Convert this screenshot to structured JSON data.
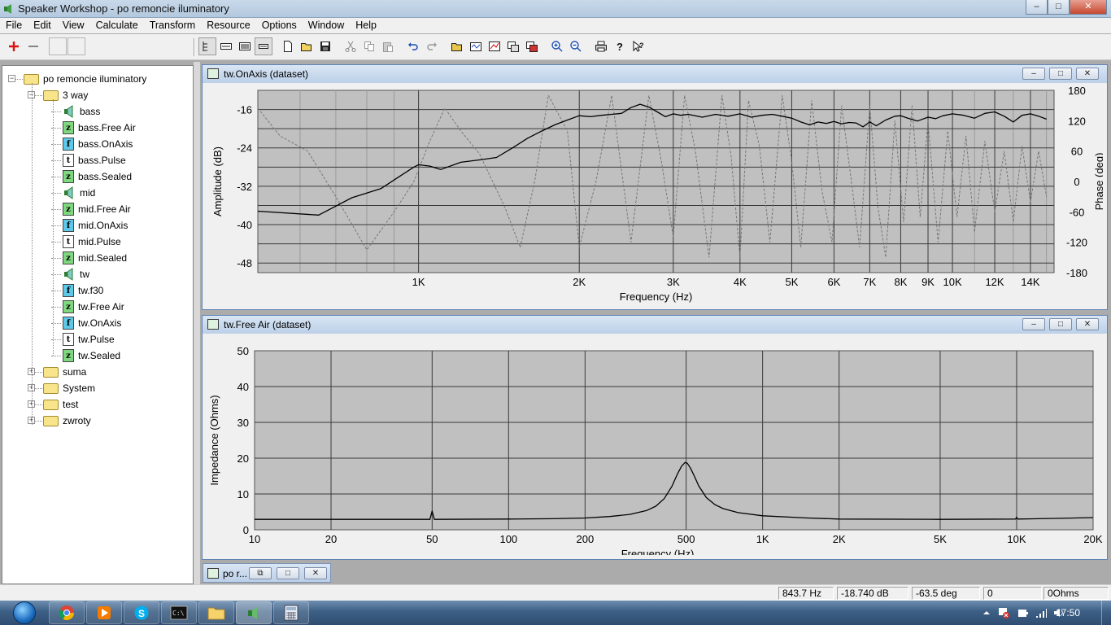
{
  "window": {
    "title": "Speaker Workshop - po remoncie iluminatory",
    "minimize": "–",
    "maximize": "□",
    "close": "✕"
  },
  "menu": [
    "File",
    "Edit",
    "View",
    "Calculate",
    "Transform",
    "Resource",
    "Options",
    "Window",
    "Help"
  ],
  "toolbar": {
    "icons": [
      "add-icon",
      "remove-icon",
      "blank-icon",
      "blank-icon",
      "tree-view-icon",
      "list-icon",
      "details-icon",
      "grid-icon",
      "new-document-icon",
      "open-folder-icon",
      "save-icon",
      "cut-icon",
      "copy-icon",
      "paste-icon",
      "undo-icon",
      "redo-icon",
      "open-icon",
      "chart-icon",
      "graph-icon",
      "window-icon",
      "window-close-icon",
      "zoom-in-icon",
      "zoom-out-icon",
      "print-icon",
      "help-icon",
      "context-help-icon"
    ]
  },
  "tree": {
    "root": "po remoncie iluminatory",
    "group": "3 way",
    "items": [
      {
        "label": "bass",
        "icon": "speaker"
      },
      {
        "label": "bass.Free Air",
        "icon": "z"
      },
      {
        "label": "bass.OnAxis",
        "icon": "f"
      },
      {
        "label": "bass.Pulse",
        "icon": "t"
      },
      {
        "label": "bass.Sealed",
        "icon": "z"
      },
      {
        "label": "mid",
        "icon": "speaker"
      },
      {
        "label": "mid.Free Air",
        "icon": "z"
      },
      {
        "label": "mid.OnAxis",
        "icon": "f"
      },
      {
        "label": "mid.Pulse",
        "icon": "t"
      },
      {
        "label": "mid.Sealed",
        "icon": "z"
      },
      {
        "label": "tw",
        "icon": "speaker"
      },
      {
        "label": "tw.f30",
        "icon": "f"
      },
      {
        "label": "tw.Free Air",
        "icon": "z"
      },
      {
        "label": "tw.OnAxis",
        "icon": "f"
      },
      {
        "label": "tw.Pulse",
        "icon": "t"
      },
      {
        "label": "tw.Sealed",
        "icon": "z"
      }
    ],
    "folders": [
      "suma",
      "System",
      "test",
      "zwroty"
    ]
  },
  "windows": {
    "onaxis_title": "tw.OnAxis (dataset)",
    "freeair_title": "tw.Free Air (dataset)",
    "minimized_title": "po r...",
    "btn_min": "–",
    "btn_max": "□",
    "btn_restore": "⧉",
    "btn_close": "✕"
  },
  "chart_data": [
    {
      "type": "line",
      "xlabel": "Frequency (Hz)",
      "ylabel": "Amplitude (dB)",
      "y2label": "Phase (deg)",
      "x_scale": "log",
      "xlim": [
        500,
        15500
      ],
      "ylim": [
        -50,
        -12
      ],
      "y2lim": [
        -180,
        180
      ],
      "x_ticks": [
        {
          "value": 1000,
          "label": "1K"
        },
        {
          "value": 2000,
          "label": "2K"
        },
        {
          "value": 3000,
          "label": "3K"
        },
        {
          "value": 4000,
          "label": "4K"
        },
        {
          "value": 5000,
          "label": "5K"
        },
        {
          "value": 6000,
          "label": "6K"
        },
        {
          "value": 7000,
          "label": "7K"
        },
        {
          "value": 8000,
          "label": "8K"
        },
        {
          "value": 9000,
          "label": "9K"
        },
        {
          "value": 10000,
          "label": "10K"
        },
        {
          "value": 12000,
          "label": "12K"
        },
        {
          "value": 14000,
          "label": "14K"
        }
      ],
      "y_ticks": [
        -16,
        -24,
        -32,
        -40,
        -48
      ],
      "y2_ticks": [
        180,
        120,
        60,
        0,
        -60,
        -120,
        -180
      ],
      "grid": true,
      "series": [
        {
          "role": "amplitude",
          "style": "solid",
          "color": "#000000",
          "x": [
            500,
            650,
            750,
            850,
            920,
            980,
            1000,
            1050,
            1100,
            1200,
            1300,
            1400,
            1500,
            1600,
            1700,
            1800,
            1900,
            2000,
            2100,
            2200,
            2300,
            2400,
            2500,
            2600,
            2700,
            2800,
            2900,
            3000,
            3100,
            3200,
            3400,
            3600,
            3800,
            4000,
            4200,
            4400,
            4600,
            4800,
            5000,
            5200,
            5400,
            5600,
            5800,
            6000,
            6200,
            6400,
            6600,
            6800,
            7000,
            7200,
            7500,
            7800,
            8000,
            8300,
            8600,
            9000,
            9300,
            9600,
            10000,
            10500,
            11000,
            11500,
            12000,
            12500,
            13000,
            13500,
            14000,
            14500,
            15000
          ],
          "y": [
            -37.2,
            -38.0,
            -34.4,
            -32.5,
            -30.0,
            -28.0,
            -27.5,
            -27.8,
            -28.5,
            -27.0,
            -26.5,
            -26.0,
            -24.0,
            -22.0,
            -20.5,
            -19.2,
            -18.2,
            -17.3,
            -17.5,
            -17.2,
            -17.0,
            -16.8,
            -15.6,
            -14.9,
            -15.5,
            -16.5,
            -17.5,
            -16.9,
            -17.2,
            -17.0,
            -17.6,
            -17.0,
            -17.4,
            -16.9,
            -17.6,
            -17.2,
            -17.0,
            -17.4,
            -17.8,
            -18.6,
            -19.2,
            -18.6,
            -18.9,
            -18.5,
            -19.0,
            -18.7,
            -18.8,
            -19.6,
            -18.6,
            -19.4,
            -18.2,
            -17.4,
            -17.3,
            -17.9,
            -18.4,
            -17.6,
            -17.9,
            -17.3,
            -16.9,
            -17.2,
            -17.8,
            -16.8,
            -16.5,
            -17.4,
            -18.6,
            -17.2,
            -16.9,
            -17.4,
            -18.0
          ]
        },
        {
          "role": "phase",
          "style": "dashed",
          "color": "#777777",
          "x": [
            500,
            550,
            620,
            700,
            800,
            900,
            980,
            1050,
            1120,
            1200,
            1300,
            1450,
            1550,
            1650,
            1750,
            1900,
            2000,
            2150,
            2300,
            2500,
            2700,
            2850,
            3000,
            3150,
            3300,
            3500,
            3700,
            3850,
            4000,
            4150,
            4350,
            4550,
            4800,
            5000,
            5200,
            5450,
            5700,
            5950,
            6200,
            6450,
            6700,
            7000,
            7250,
            7500,
            7800,
            8100,
            8400,
            8700,
            9000,
            9400,
            9800,
            10200,
            10600,
            11000,
            11500,
            12000,
            12500,
            13000,
            13500,
            14000,
            14500,
            15000
          ],
          "y": [
            145,
            90,
            60,
            -30,
            -135,
            -60,
            0,
            80,
            145,
            100,
            55,
            -50,
            -130,
            0,
            170,
            100,
            -130,
            0,
            170,
            -120,
            170,
            40,
            -110,
            170,
            60,
            -150,
            170,
            50,
            -150,
            160,
            70,
            -120,
            170,
            40,
            -130,
            160,
            -20,
            -120,
            150,
            10,
            -130,
            150,
            -50,
            -150,
            120,
            -80,
            150,
            -70,
            120,
            -120,
            100,
            -70,
            90,
            -100,
            80,
            -60,
            60,
            -80,
            70,
            -40,
            60,
            -30
          ]
        }
      ]
    },
    {
      "type": "line",
      "xlabel": "Frequency (Hz)",
      "ylabel": "Impedance (Ohms)",
      "x_scale": "log",
      "xlim": [
        10,
        20000
      ],
      "ylim": [
        0,
        50
      ],
      "x_ticks": [
        {
          "value": 10,
          "label": "10"
        },
        {
          "value": 20,
          "label": "20"
        },
        {
          "value": 50,
          "label": "50"
        },
        {
          "value": 100,
          "label": "100"
        },
        {
          "value": 200,
          "label": "200"
        },
        {
          "value": 500,
          "label": "500"
        },
        {
          "value": 1000,
          "label": "1K"
        },
        {
          "value": 2000,
          "label": "2K"
        },
        {
          "value": 5000,
          "label": "5K"
        },
        {
          "value": 10000,
          "label": "10K"
        },
        {
          "value": 20000,
          "label": "20K"
        }
      ],
      "y_ticks": [
        50,
        40,
        30,
        20,
        10,
        0
      ],
      "grid": true,
      "series": [
        {
          "role": "impedance",
          "style": "solid",
          "color": "#000000",
          "x": [
            10,
            20,
            49,
            50,
            51,
            100,
            150,
            200,
            250,
            300,
            350,
            380,
            410,
            440,
            460,
            480,
            495,
            505,
            520,
            540,
            560,
            600,
            650,
            700,
            800,
            1000,
            1500,
            2000,
            5000,
            9900,
            10000,
            10100,
            15000,
            20000
          ],
          "y": [
            2.9,
            2.9,
            2.9,
            5.2,
            2.9,
            3.0,
            3.1,
            3.3,
            3.7,
            4.3,
            5.4,
            6.6,
            8.7,
            12.2,
            15.3,
            17.8,
            18.8,
            18.6,
            17.2,
            14.8,
            12.3,
            9.0,
            7.0,
            5.9,
            4.8,
            3.9,
            3.3,
            3.0,
            2.9,
            3.0,
            3.5,
            3.0,
            3.2,
            3.4
          ]
        }
      ]
    }
  ],
  "status": {
    "freq": "843.7 Hz",
    "db": "-18.740 dB",
    "deg": "-63.5 deg",
    "val": "0",
    "ohms": "0Ohms"
  },
  "taskbar": {
    "apps": [
      "chrome-icon",
      "media-player-icon",
      "skype-icon",
      "cmd-icon",
      "explorer-icon",
      "speaker-workshop-icon",
      "calculator-icon"
    ],
    "clock": "17:50"
  },
  "colors": {
    "plot_bg": "#c0c0c0",
    "titlebar": "#bcd0e8",
    "taskbar": "#3d5f85"
  }
}
